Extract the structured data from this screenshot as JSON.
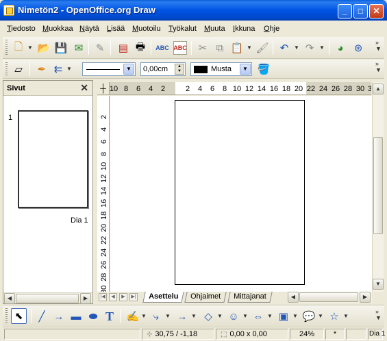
{
  "window": {
    "title": "Nimetön2 - OpenOffice.org Draw",
    "minimize_glyph": "_",
    "maximize_glyph": "□",
    "close_glyph": "✕"
  },
  "menu": {
    "items": [
      {
        "mnemonic": "T",
        "rest": "iedosto"
      },
      {
        "mnemonic": "M",
        "rest": "uokkaa"
      },
      {
        "mnemonic": "N",
        "rest": "äytä"
      },
      {
        "mnemonic": "L",
        "rest": "isää"
      },
      {
        "mnemonic": "M",
        "rest": "uotoilu"
      },
      {
        "mnemonic": "T",
        "rest": "yökalut"
      },
      {
        "mnemonic": "M",
        "rest": "uuta"
      },
      {
        "mnemonic": "I",
        "rest": "kkuna"
      },
      {
        "mnemonic": "O",
        "rest": "hje"
      }
    ]
  },
  "standard_toolbar": {
    "icons": [
      "new-icon",
      "open-icon",
      "save-icon",
      "email-icon",
      "edit-file-icon",
      "export-pdf-icon",
      "print-icon",
      "spellcheck-icon",
      "autospellcheck-icon",
      "cut-icon",
      "copy-icon",
      "paste-icon",
      "clone-format-icon",
      "undo-icon",
      "redo-icon",
      "chart-icon",
      "navigator-icon"
    ]
  },
  "line_toolbar": {
    "line_width": "0,00cm",
    "line_color_name": "Musta",
    "line_color": "#000000"
  },
  "slides_pane": {
    "title": "Sivut",
    "close_glyph": "✕",
    "slides": [
      {
        "number": "1",
        "label": "Dia 1"
      }
    ]
  },
  "ruler": {
    "horizontal_ticks": [
      "10",
      "8",
      "6",
      "4",
      "2",
      "2",
      "4",
      "6",
      "8",
      "10",
      "12",
      "14",
      "16",
      "18",
      "20",
      "22",
      "24",
      "26",
      "28",
      "30",
      "3"
    ],
    "vertical_ticks": [
      "2",
      "4",
      "6",
      "8",
      "10",
      "12",
      "14",
      "16",
      "18",
      "20",
      "22",
      "24",
      "26",
      "28",
      "30"
    ]
  },
  "tabs": [
    {
      "label": "Asettelu",
      "active": true
    },
    {
      "label": "Ohjaimet",
      "active": false
    },
    {
      "label": "Mittajanat",
      "active": false
    }
  ],
  "drawing_toolbar": {
    "tools": [
      "select-icon",
      "line-icon",
      "arrow-line-icon",
      "rectangle-icon",
      "ellipse-icon",
      "text-icon",
      "curve-icon",
      "connector-icon",
      "lines-arrows-icon",
      "basic-shapes-icon",
      "symbol-shapes-icon",
      "block-arrows-icon",
      "flowchart-icon",
      "callouts-icon",
      "stars-icon"
    ]
  },
  "status": {
    "position": "30,75 / -1,18",
    "size": "0,00 x 0,00",
    "zoom": "24%",
    "modified": "*",
    "page": "Dia 1"
  }
}
